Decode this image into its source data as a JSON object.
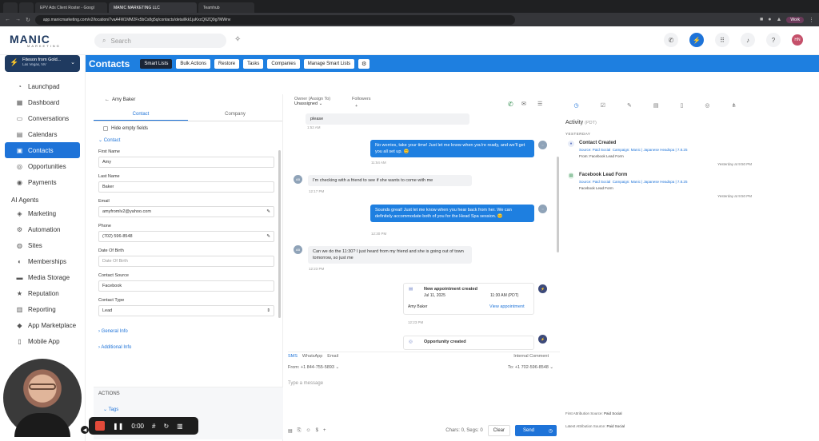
{
  "browser": {
    "tabs": [
      "EPV Ads Client Roster - Googl",
      "MANIC MARKETING LLC",
      "Teamhub"
    ],
    "url": "app.manicmarketing.com/v2/location/7vaA4W1MM2Fx5bCs8g5q/contacts/detail/kk1juKxcQ6ZQ9g7MWnv",
    "profile": "Work"
  },
  "topbar": {
    "logo": "MANIC",
    "logo_sub": "MARKETING",
    "search_placeholder": "Search",
    "avatar_initials": "HN"
  },
  "sidebar": {
    "account_name": "Fiteson from Gold...",
    "account_location": "Las Vegas, NV",
    "items": [
      {
        "label": "Launchpad",
        "icon": "rocket-icon",
        "glyph": "◔"
      },
      {
        "label": "Dashboard",
        "icon": "grid-icon",
        "glyph": "▦"
      },
      {
        "label": "Conversations",
        "icon": "chat-icon",
        "glyph": "▭"
      },
      {
        "label": "Calendars",
        "icon": "calendar-icon",
        "glyph": "▤"
      },
      {
        "label": "Contacts",
        "icon": "contacts-icon",
        "glyph": "▣",
        "active": true
      },
      {
        "label": "Opportunities",
        "icon": "target-icon",
        "glyph": "◎"
      },
      {
        "label": "Payments",
        "icon": "payment-icon",
        "glyph": "◉"
      }
    ],
    "section": "AI Agents",
    "items2": [
      {
        "label": "Marketing",
        "icon": "megaphone-icon",
        "glyph": "◈"
      },
      {
        "label": "Automation",
        "icon": "automation-icon",
        "glyph": "⚙"
      },
      {
        "label": "Sites",
        "icon": "globe-icon",
        "glyph": "◍"
      },
      {
        "label": "Memberships",
        "icon": "members-icon",
        "glyph": "◐"
      },
      {
        "label": "Media Storage",
        "icon": "folder-icon",
        "glyph": "▬"
      },
      {
        "label": "Reputation",
        "icon": "star-icon",
        "glyph": "★"
      },
      {
        "label": "Reporting",
        "icon": "chart-icon",
        "glyph": "▥"
      },
      {
        "label": "App Marketplace",
        "icon": "apps-icon",
        "glyph": "◆"
      },
      {
        "label": "Mobile App",
        "icon": "mobile-icon",
        "glyph": "▯"
      }
    ]
  },
  "header": {
    "title": "Contacts",
    "buttons": [
      "Smart Lists",
      "Bulk Actions",
      "Restore",
      "Tasks",
      "Companies",
      "Manage Smart Lists"
    ]
  },
  "contact": {
    "name": "Amy Baker",
    "tabs": [
      "Contact",
      "Company"
    ],
    "hide_empty": "Hide empty fields",
    "section_contact": "Contact",
    "fields": {
      "first_name_label": "First Name",
      "first_name": "Amy",
      "last_name_label": "Last Name",
      "last_name": "Baker",
      "email_label": "Email",
      "email": "amyfromlv2@yahoo.com",
      "phone_label": "Phone",
      "phone": "(702) 596-8548",
      "dob_label": "Date Of Birth",
      "dob_placeholder": "Date Of Birth",
      "source_label": "Contact Source",
      "source": "Facebook",
      "type_label": "Contact Type",
      "type": "Lead"
    },
    "general_info": "General Info",
    "additional_info": "Additional Info",
    "actions": "ACTIONS",
    "tags": "Tags"
  },
  "chat": {
    "owner_label": "Owner (Assign To)",
    "owner_value": "Unassigned",
    "followers_label": "Followers",
    "followers_value": "+",
    "m0": "please",
    "t0": "1:52 AM",
    "m1": "No worries, take your time! Just let me know when you're ready, and we'll get you all set up. 😊",
    "t1": "11:54 AM",
    "m2": "I'm checking with a friend to see if she wants to come with me",
    "t2": "12:17 PM",
    "m3": "Sounds great! Just let me know when you hear back from her. We can definitely accommodate both of you for the Head Spa session. 😊",
    "t3": "12:30 PM",
    "m4": "Can we do the 11:30? I just heard from my friend and she is going out of town tomorrow, so just me",
    "t4": "12:23 PM",
    "appt_title": "New appointment created",
    "appt_date": "Jul 11, 2025",
    "appt_time": "11:30 AM (PDT)",
    "appt_name": "Amy Baker",
    "appt_link": "View appointment",
    "t5": "12:23 PM",
    "opp_title": "Opportunity created",
    "avatar_initials": "AB",
    "compose_tabs": [
      "SMS",
      "WhatsApp",
      "Email"
    ],
    "internal_comment": "Internal Comment",
    "from": "From:  +1 844-755-5893",
    "to": "To:  +1 702-596-8548",
    "placeholder": "Type a message",
    "counter": "Chars: 0, Segs: 0",
    "clear": "Clear",
    "send": "Send"
  },
  "activity": {
    "title": "Activity",
    "tz": "(PDT)",
    "day": "YESTERDAY",
    "items": [
      {
        "title": "Contact Created",
        "source": "Source: Paid Social",
        "campaign": "Campaign: Manic | Japanese Headspa | 7.8.25",
        "from": "From: Facebook Lead Form",
        "when": "Yesterday at 9:50 PM"
      },
      {
        "title": "Facebook Lead Form",
        "source": "Source: Paid Social",
        "campaign": "Campaign: Manic | Japanese Headspa | 7.8.25",
        "from": "Facebook Lead Form",
        "when": "Yesterday at 9:50 PM"
      }
    ],
    "first_attr_label": "First Attribution Source:",
    "first_attr": "Paid Social",
    "latest_attr_label": "Latest Attribution Source:",
    "latest_attr": "Paid Social"
  },
  "recorder": {
    "time": "0:00"
  }
}
